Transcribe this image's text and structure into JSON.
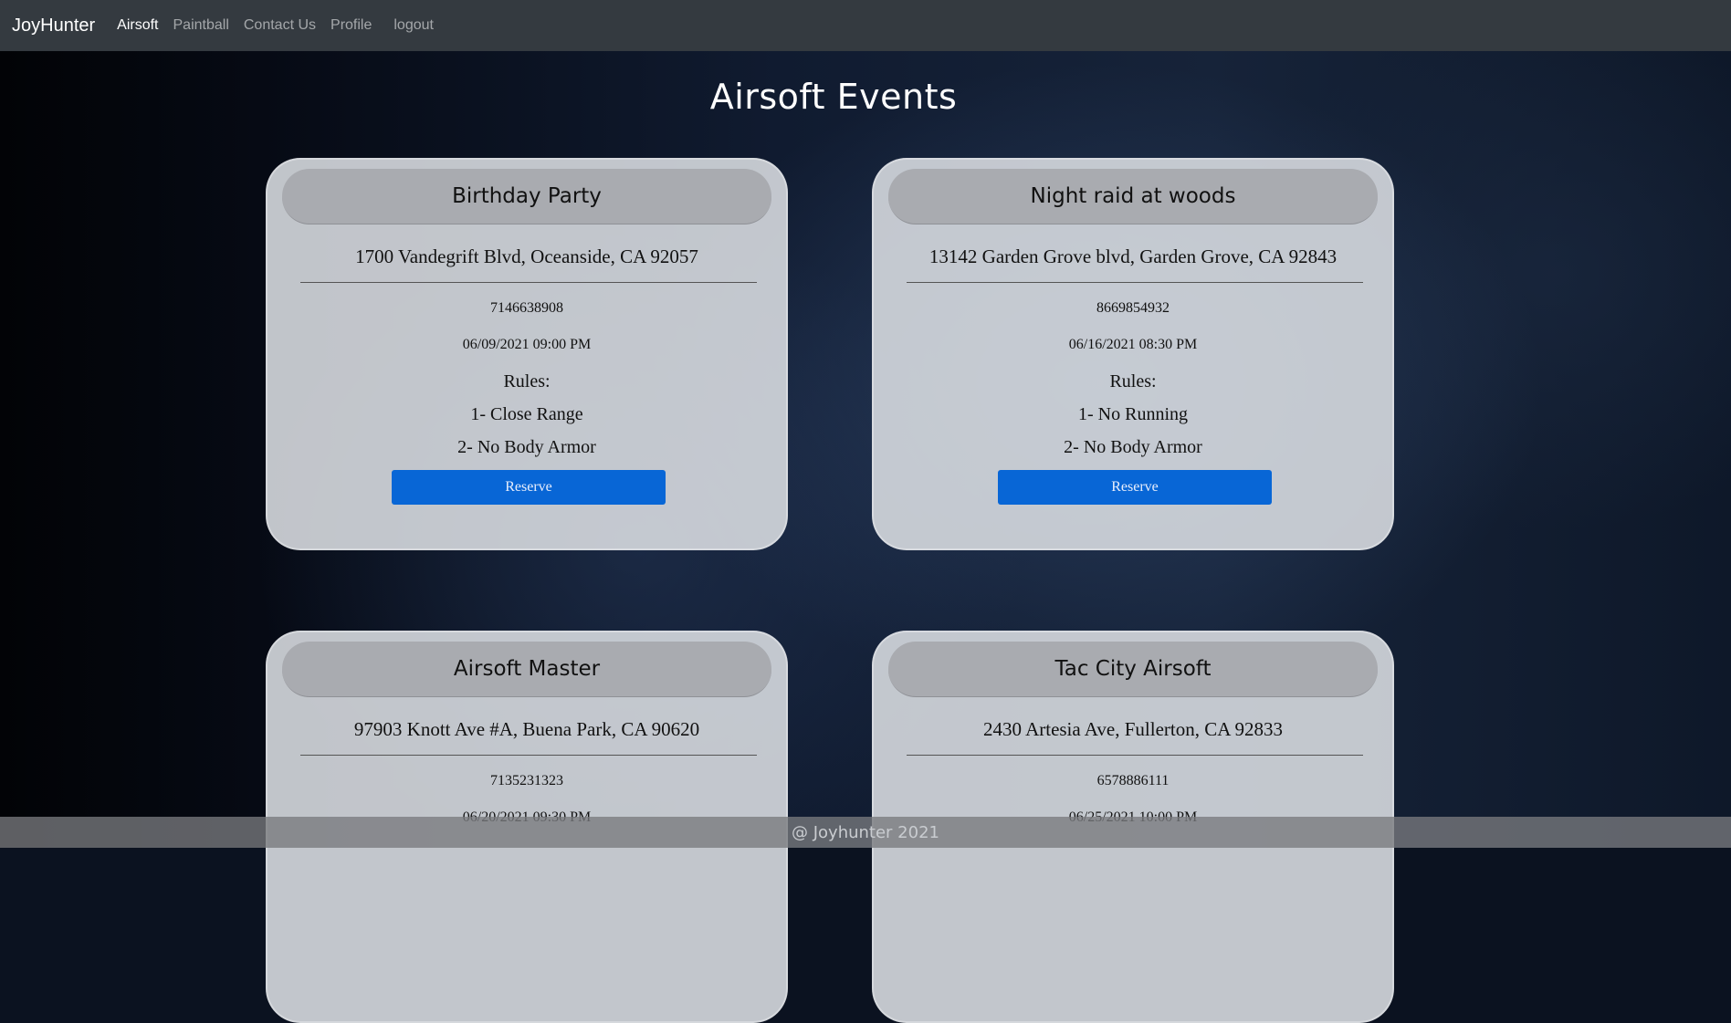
{
  "nav": {
    "brand": "JoyHunter",
    "links": [
      "Airsoft",
      "Paintball",
      "Contact Us",
      "Profile",
      "logout"
    ]
  },
  "page": {
    "title": "Airsoft Events"
  },
  "events": [
    {
      "name": "Birthday Party",
      "address": "1700 Vandegrift Blvd, Oceanside, CA 92057",
      "phone": "7146638908",
      "datetime": "06/09/2021 09:00 PM",
      "rules_title": "Rules:",
      "rule1": "1- Close Range",
      "rule2": "2- No Body Armor",
      "button": "Reserve"
    },
    {
      "name": "Night raid at woods",
      "address": "13142 Garden Grove blvd, Garden Grove, CA 92843",
      "phone": "8669854932",
      "datetime": "06/16/2021 08:30 PM",
      "rules_title": "Rules:",
      "rule1": "1- No Running",
      "rule2": "2- No Body Armor",
      "button": "Reserve"
    },
    {
      "name": "Airsoft Master",
      "address": "97903 Knott Ave #A, Buena Park, CA 90620",
      "phone": "7135231323",
      "datetime": "06/20/2021 09:30 PM"
    },
    {
      "name": "Tac City Airsoft",
      "address": "2430 Artesia Ave, Fullerton, CA 92833",
      "phone": "6578886111",
      "datetime": "06/25/2021 10:00 PM"
    }
  ],
  "footer": {
    "text": "@ Joyhunter 2021"
  }
}
